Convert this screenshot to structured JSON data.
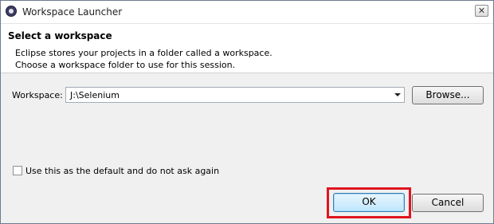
{
  "window": {
    "title": "Workspace Launcher",
    "close_glyph": "✕"
  },
  "header": {
    "title": "Select a workspace",
    "desc_line1": "Eclipse stores your projects in a folder called a workspace.",
    "desc_line2": "Choose a workspace folder to use for this session."
  },
  "workspace": {
    "label": "Workspace:",
    "value": "J:\\Selenium",
    "browse_label": "Browse..."
  },
  "default_checkbox": {
    "label": "Use this as the default and do not ask again",
    "checked": false
  },
  "buttons": {
    "ok_label": "OK",
    "cancel_label": "Cancel"
  },
  "colors": {
    "highlight": "#e0141e",
    "ok_button": "#bee6fd"
  },
  "icons": {
    "app": "eclipse-icon",
    "close": "close-icon",
    "dropdown": "chevron-down-icon"
  }
}
